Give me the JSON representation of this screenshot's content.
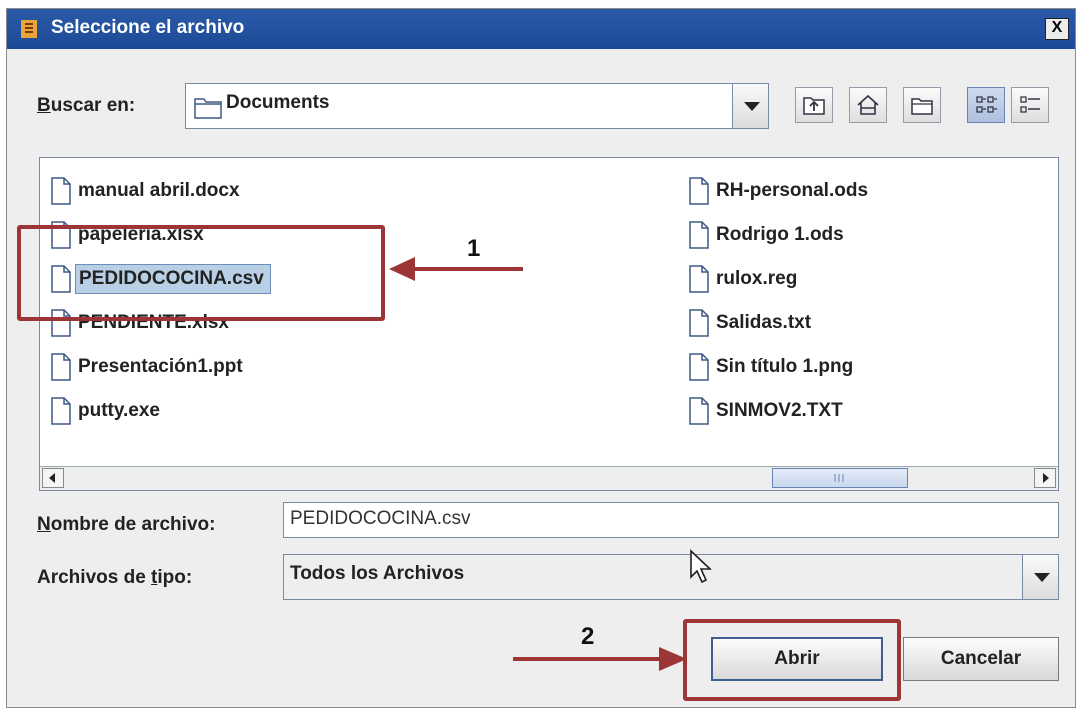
{
  "window": {
    "title": "Seleccione el archivo",
    "close_glyph": "X"
  },
  "lookin": {
    "label_underlined": "B",
    "label_rest": "uscar en:",
    "value": "Documents"
  },
  "toolbar": [
    "up-one-level-icon",
    "home-icon",
    "new-folder-icon",
    "list-view-icon",
    "details-view-icon"
  ],
  "files": {
    "left": [
      "manual abril.docx",
      "papeleria.xlsx",
      "PEDIDOCOCINA.csv",
      "PENDIENTE.xlsx",
      "Presentación1.ppt",
      "putty.exe"
    ],
    "right": [
      "RH-personal.ods",
      "Rodrigo 1.ods",
      "rulox.reg",
      "Salidas.txt",
      "Sin título 1.png",
      "SINMOV2.TXT"
    ]
  },
  "filename": {
    "label_underlined": "N",
    "label_rest": "ombre de archivo:",
    "value": "PEDIDOCOCINA.csv"
  },
  "filetype": {
    "label_before": "Archivos de ",
    "label_underlined": "t",
    "label_after": "ipo:",
    "value": "Todos los Archivos"
  },
  "buttons": {
    "open": "Abrir",
    "cancel": "Cancelar"
  },
  "annotations": {
    "step1": "1",
    "step2": "2"
  },
  "colors": {
    "annotation": "#9c3535",
    "titlebar": "#1d4a96",
    "selection": "#b8cfe5"
  }
}
